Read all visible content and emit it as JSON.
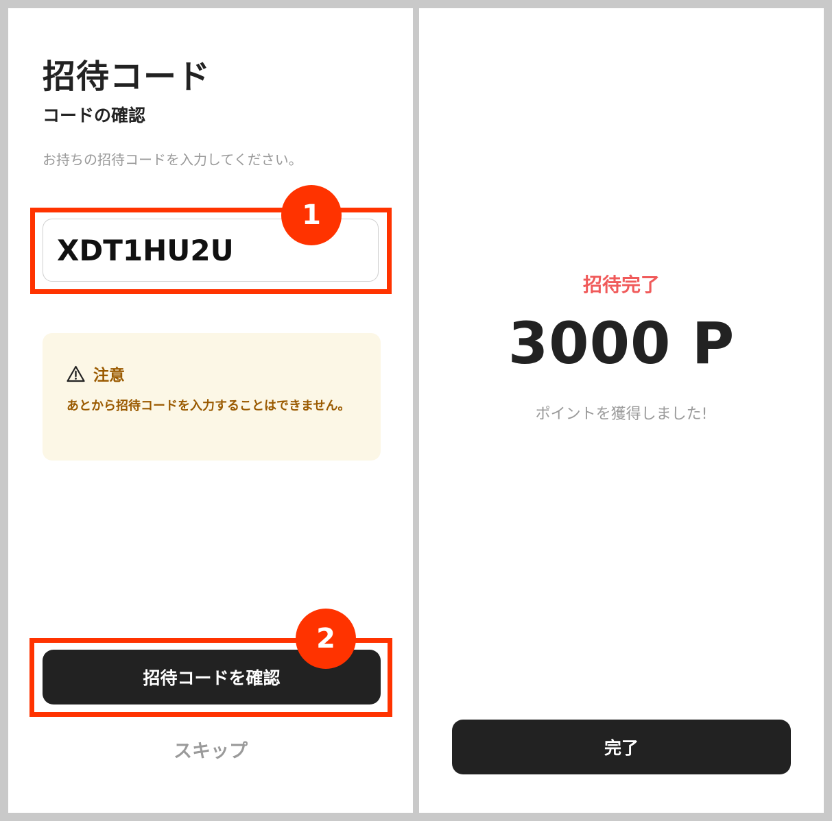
{
  "invite_screen": {
    "title": "招待コード",
    "subtitle": "コードの確認",
    "instruction": "お持ちの招待コードを入力してください。",
    "code_value": "XDT1HU2U",
    "notice": {
      "icon": "warning-triangle-icon",
      "title": "注意",
      "message": "あとから招待コードを入力することはできません。"
    },
    "confirm_button_label": "招待コードを確認",
    "skip_label": "スキップ"
  },
  "annotations": {
    "step_1": "1",
    "step_2": "2",
    "highlight_color": "#ff3300"
  },
  "result_screen": {
    "status_label": "招待完了",
    "points": "3000 P",
    "message": "ポイントを獲得しました!",
    "done_button_label": "完了"
  },
  "colors": {
    "button_bg": "#222222",
    "status_accent": "#f05a5a",
    "notice_bg": "#fcf7e6",
    "notice_text": "#9a5a00"
  }
}
